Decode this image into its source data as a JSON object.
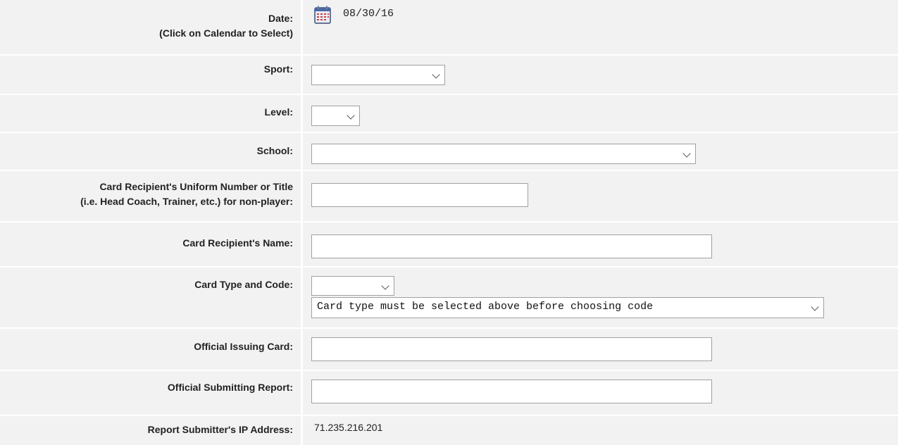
{
  "date": {
    "label_line1": "Date:",
    "label_line2": "(Click on Calendar to Select)",
    "value": "08/30/16",
    "icon": "calendar-icon"
  },
  "sport": {
    "label": "Sport:",
    "value": ""
  },
  "level": {
    "label": "Level:",
    "value": ""
  },
  "school": {
    "label": "School:",
    "value": ""
  },
  "uniform": {
    "label_line1": "Card Recipient's Uniform Number or Title",
    "label_line2": "(i.e. Head Coach, Trainer, etc.) for non-player:",
    "value": ""
  },
  "recipient_name": {
    "label": "Card Recipient's Name:",
    "value": ""
  },
  "card_type": {
    "label": "Card Type and Code:",
    "type_value": "",
    "code_value": "Card type must be selected above before choosing code"
  },
  "official_issuing": {
    "label": "Official Issuing Card:",
    "value": ""
  },
  "official_submitting": {
    "label": "Official Submitting Report:",
    "value": ""
  },
  "ip": {
    "label": "Report Submitter's IP Address:",
    "value": "71.235.216.201"
  }
}
